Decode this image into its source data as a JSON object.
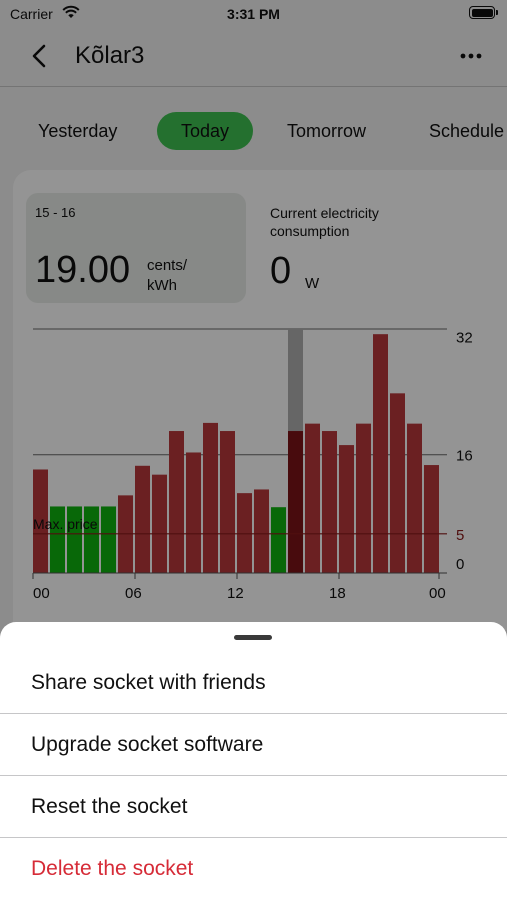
{
  "status_bar": {
    "carrier": "Carrier",
    "time": "3:31 PM"
  },
  "nav": {
    "title": "Kõlar3"
  },
  "tabs": [
    {
      "label": "Yesterday",
      "active": false
    },
    {
      "label": "Today",
      "active": true
    },
    {
      "label": "Tomorrow",
      "active": false
    },
    {
      "label": "Schedule",
      "active": false
    }
  ],
  "price": {
    "range": "15 - 16",
    "value": "19.00",
    "unit": "cents/ kWh"
  },
  "consumption": {
    "label": "Current electricity consumption",
    "value": "0",
    "unit": "W"
  },
  "chart_data": {
    "type": "bar",
    "categories": [
      "00",
      "01",
      "02",
      "03",
      "04",
      "05",
      "06",
      "07",
      "08",
      "09",
      "10",
      "11",
      "12",
      "13",
      "14",
      "15",
      "16",
      "17",
      "18",
      "19",
      "20",
      "21",
      "22",
      "23"
    ],
    "values": [
      14,
      9,
      9,
      9,
      9,
      10.5,
      14.5,
      13.3,
      19.2,
      16.3,
      20.3,
      19.2,
      10.8,
      11.3,
      8.9,
      19.2,
      20.2,
      19.2,
      17.3,
      20.2,
      32.3,
      24.3,
      20.2,
      14.6
    ],
    "max_price": 5,
    "max_price_label": "Max. price",
    "current_hour_index": 15,
    "ylim": [
      0,
      33
    ],
    "y_ticks": [
      0,
      16,
      32
    ],
    "x_tick_labels": [
      "00",
      "06",
      "12",
      "18",
      "00"
    ],
    "colors": {
      "below": "#0fb40f",
      "above": "#b8383c",
      "current": "#7d1418",
      "highlight": "#b0b0b0",
      "max_line": "#8a1b1b"
    }
  },
  "sheet": {
    "items": [
      {
        "label": "Share socket with friends"
      },
      {
        "label": "Upgrade socket software"
      },
      {
        "label": "Reset the socket"
      },
      {
        "label": "Delete the socket",
        "danger": true
      }
    ]
  }
}
